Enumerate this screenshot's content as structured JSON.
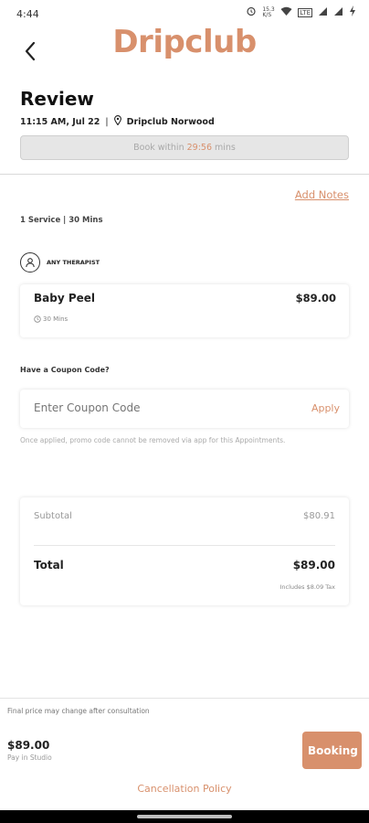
{
  "status_bar": {
    "time": "4:44",
    "network": "LTE",
    "speed": "15.3 K/S"
  },
  "header": {
    "brand": "Dripclub",
    "back_icon": "back-arrow-icon"
  },
  "review": {
    "title": "Review",
    "datetime": "11:15 AM, Jul 22",
    "location": "Dripclub Norwood",
    "banner_prefix": "Book within ",
    "banner_timer": "29:56",
    "banner_suffix": " mins"
  },
  "notes": {
    "add_label": "Add Notes"
  },
  "service_summary": "1 Service | 30 Mins",
  "therapist": {
    "label": "ANY THERAPIST"
  },
  "service": {
    "name": "Baby Peel",
    "price": "$89.00",
    "duration": "30 Mins"
  },
  "coupon": {
    "question": "Have a Coupon Code?",
    "placeholder": "Enter Coupon Code",
    "apply_label": "Apply",
    "note": "Once applied, promo code cannot be removed via app for this Appointments."
  },
  "summary": {
    "subtotal_label": "Subtotal",
    "subtotal_value": "$80.91",
    "total_label": "Total",
    "total_value": "$89.00",
    "tax_note": "Includes $8.09 Tax"
  },
  "footer": {
    "final_note": "Final price may change after consultation",
    "price": "$89.00",
    "pay_note": "Pay in Studio",
    "booking_label": "Booking",
    "cancellation_label": "Cancellation Policy"
  },
  "colors": {
    "accent": "#d8906c",
    "banner_bg": "#e6e6e6"
  }
}
